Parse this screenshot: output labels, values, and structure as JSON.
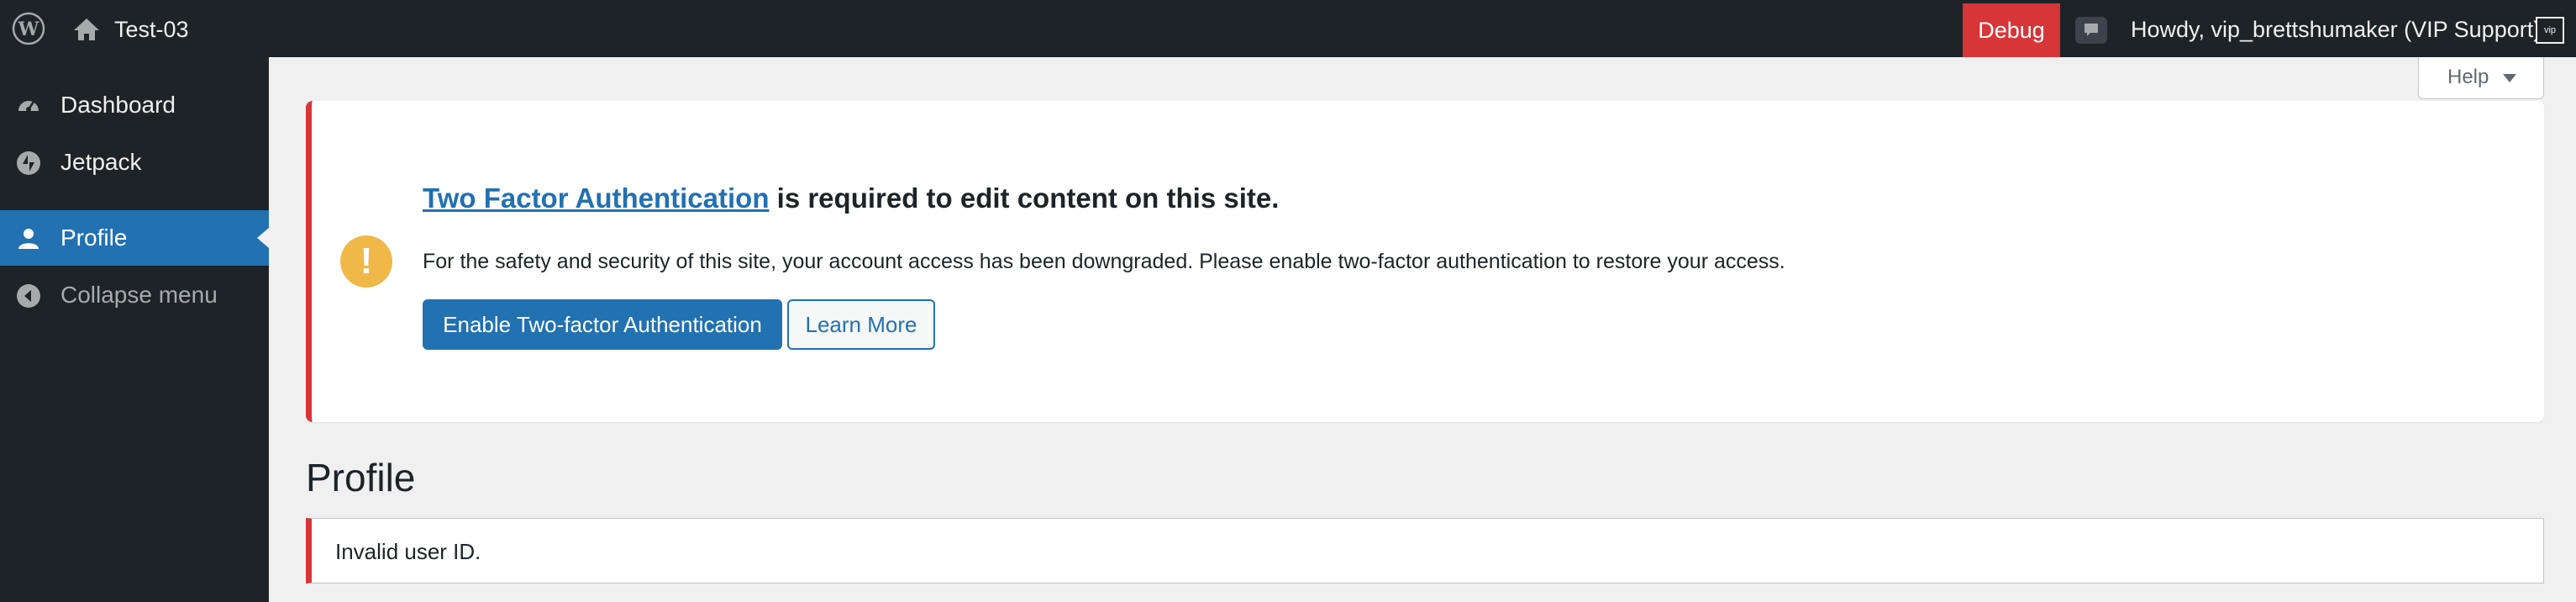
{
  "admin_bar": {
    "site_name": "Test-03",
    "debug_label": "Debug",
    "greeting": "Howdy, vip_brettshumaker (VIP Support)",
    "avatar_text": "vip"
  },
  "sidebar": {
    "items": [
      {
        "label": "Dashboard",
        "icon": "dashboard-icon"
      },
      {
        "label": "Jetpack",
        "icon": "jetpack-icon"
      },
      {
        "label": "Profile",
        "icon": "user-icon",
        "current": true
      },
      {
        "label": "Collapse menu",
        "icon": "collapse-icon"
      }
    ]
  },
  "help": {
    "label": "Help"
  },
  "notice": {
    "title_link": "Two Factor Authentication",
    "title_rest": " is required to edit content on this site.",
    "body": "For the safety and security of this site, your account access has been downgraded. Please enable two-factor authentication to restore your access.",
    "primary_button": "Enable Two-factor Authentication",
    "secondary_button": "Learn More",
    "icon": "!"
  },
  "page": {
    "title": "Profile",
    "error": "Invalid user ID."
  },
  "colors": {
    "admin_bar": "#1d2327",
    "accent": "#2271b1",
    "error": "#d63638",
    "warning": "#f0b849"
  }
}
